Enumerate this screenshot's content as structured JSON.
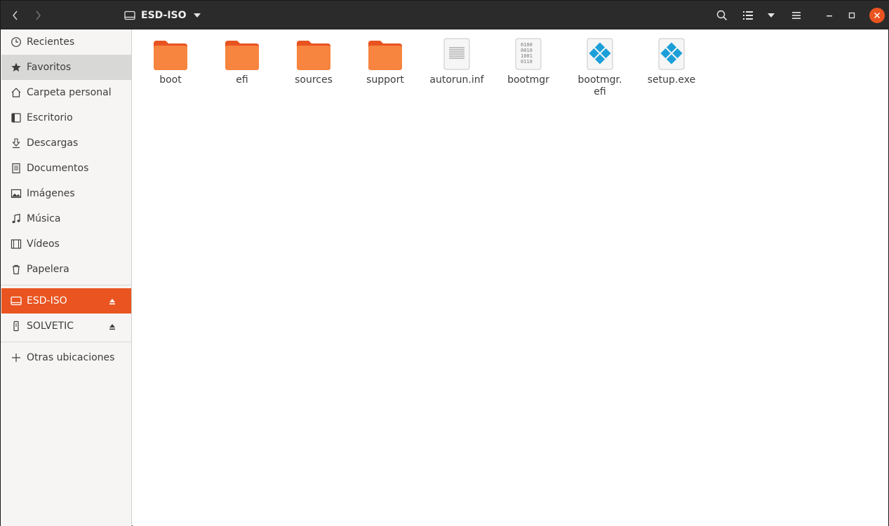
{
  "window": {
    "title": "ESD-ISO"
  },
  "sidebar": {
    "items": [
      {
        "label": "Recientes",
        "icon": "clock-icon"
      },
      {
        "label": "Favoritos",
        "icon": "star-icon"
      },
      {
        "label": "Carpeta personal",
        "icon": "home-icon"
      },
      {
        "label": "Escritorio",
        "icon": "desktop-icon"
      },
      {
        "label": "Descargas",
        "icon": "download-icon"
      },
      {
        "label": "Documentos",
        "icon": "document-icon"
      },
      {
        "label": "Imágenes",
        "icon": "image-icon"
      },
      {
        "label": "Música",
        "icon": "music-icon"
      },
      {
        "label": "Vídeos",
        "icon": "video-icon"
      },
      {
        "label": "Papelera",
        "icon": "trash-icon"
      }
    ],
    "devices": [
      {
        "label": "ESD-ISO",
        "icon": "drive-icon"
      },
      {
        "label": "SOLVETIC",
        "icon": "usb-icon"
      }
    ],
    "other": {
      "label": "Otras ubicaciones",
      "icon": "plus-icon"
    }
  },
  "files": [
    {
      "name": "boot",
      "type": "folder"
    },
    {
      "name": "efi",
      "type": "folder"
    },
    {
      "name": "sources",
      "type": "folder"
    },
    {
      "name": "support",
      "type": "folder"
    },
    {
      "name": "autorun.inf",
      "type": "text"
    },
    {
      "name": "bootmgr",
      "type": "binary"
    },
    {
      "name": "bootmgr.\nefi",
      "type": "exe"
    },
    {
      "name": "setup.exe",
      "type": "exe"
    }
  ],
  "colors": {
    "accent": "#e95420",
    "folder": "#f4772e",
    "exe": "#1c9fd8"
  }
}
